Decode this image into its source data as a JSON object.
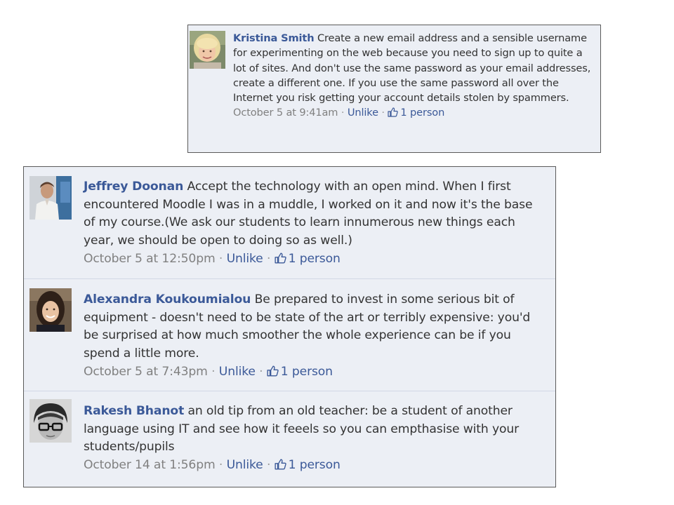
{
  "comments": [
    {
      "author": "Kristina Smith",
      "text": "Create a new email address and a sensible username for experimenting on the web because you need to sign up to quite a lot of sites. And don't use the same password as your email addresses, create a different one. If you use the same password all over the Internet you risk getting your account details stolen by spammers.",
      "timestamp": "October 5 at 9:41am",
      "unlike_label": "Unlike",
      "likes": "1 person",
      "avatar": "avatar-blonde-woman"
    },
    {
      "author": "Jeffrey Doonan",
      "text": "Accept the technology with an open mind. When I first encountered Moodle I was in a muddle, I worked on it and now it's the base of my course.(We ask our students to learn innumerous new things each year, we should be open to doing so as well.)",
      "timestamp": "October 5 at 12:50pm",
      "unlike_label": "Unlike",
      "likes": "1 person",
      "avatar": "avatar-man-presenting"
    },
    {
      "author": "Alexandra Koukoumialou",
      "text": "Be prepared to invest in some serious bit of equipment - doesn't need to be state of the art or terribly expensive: you'd be surprised at how much smoother the whole experience can be if you spend a little more.",
      "timestamp": "October 5 at 7:43pm",
      "unlike_label": "Unlike",
      "likes": "1 person",
      "avatar": "avatar-woman-dark-hair"
    },
    {
      "author": "Rakesh Bhanot",
      "text": "an old tip from an old teacher: be a student of another language using IT and see how it feeels so you can empthasise with your students/pupils",
      "timestamp": "October 14 at 1:56pm",
      "unlike_label": "Unlike",
      "likes": "1 person",
      "avatar": "avatar-man-glasses"
    }
  ],
  "separator": "·",
  "colors": {
    "panel_bg": "#eceff5",
    "link": "#3b5998",
    "meta": "#808080",
    "text": "#333333"
  }
}
